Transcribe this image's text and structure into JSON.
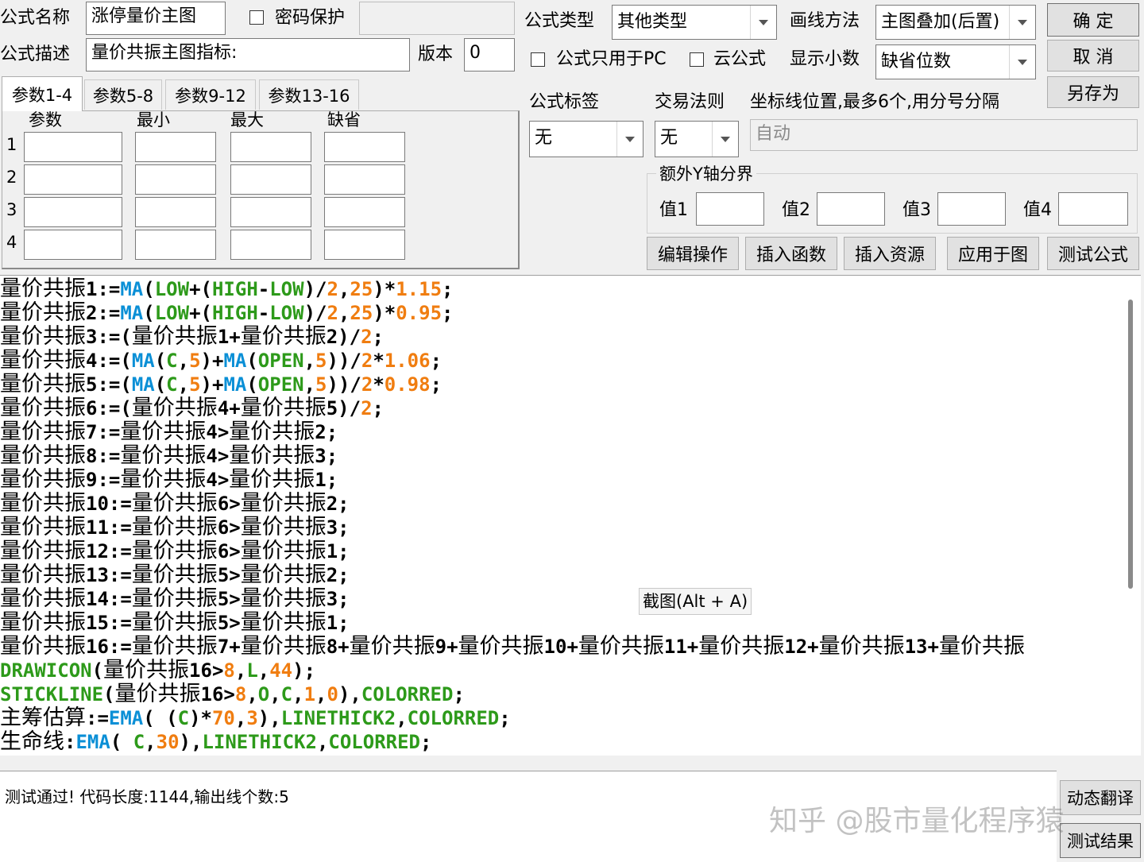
{
  "top": {
    "name_label": "公式名称",
    "name_value": "涨停量价主图",
    "password_label": "密码保护",
    "desc_label": "公式描述",
    "desc_value": "量价共振主图指标:",
    "version_label": "版本",
    "version_value": "0",
    "type_label": "公式类型",
    "type_value": "其他类型",
    "draw_label": "画线方法",
    "draw_value": "主图叠加(后置)",
    "pc_only_label": "公式只用于PC",
    "cloud_label": "云公式",
    "decimal_label": "显示小数",
    "decimal_value": "缺省位数",
    "ok": "确  定",
    "cancel": "取  消",
    "save_as": "另存为"
  },
  "tabs": [
    "参数1-4",
    "参数5-8",
    "参数9-12",
    "参数13-16"
  ],
  "params": {
    "headers": [
      "参数",
      "最小",
      "最大",
      "缺省"
    ],
    "rows": [
      "1",
      "2",
      "3",
      "4"
    ]
  },
  "right": {
    "tag_label": "公式标签",
    "tag_value": "无",
    "rule_label": "交易法则",
    "rule_value": "无",
    "axis_label": "坐标线位置,最多6个,用分号分隔",
    "axis_placeholder": "自动",
    "yaxis_group": "额外Y轴分界",
    "v1": "值1",
    "v2": "值2",
    "v3": "值3",
    "v4": "值4"
  },
  "actions": [
    "编辑操作",
    "插入函数",
    "插入资源",
    "应用于图",
    "测试公式"
  ],
  "code_lines": [
    "量价共振1:=MA(LOW+(HIGH-LOW)/2,25)*1.15;",
    "量价共振2:=MA(LOW+(HIGH-LOW)/2,25)*0.95;",
    "量价共振3:=(量价共振1+量价共振2)/2;",
    "量价共振4:=(MA(C,5)+MA(OPEN,5))/2*1.06;",
    "量价共振5:=(MA(C,5)+MA(OPEN,5))/2*0.98;",
    "量价共振6:=(量价共振4+量价共振5)/2;",
    "量价共振7:=量价共振4>量价共振2;",
    "量价共振8:=量价共振4>量价共振3;",
    "量价共振9:=量价共振4>量价共振1;",
    "量价共振10:=量价共振6>量价共振2;",
    "量价共振11:=量价共振6>量价共振3;",
    "量价共振12:=量价共振6>量价共振1;",
    "量价共振13:=量价共振5>量价共振2;",
    "量价共振14:=量价共振5>量价共振3;",
    "量价共振15:=量价共振5>量价共振1;",
    "量价共振16:=量价共振7+量价共振8+量价共振9+量价共振10+量价共振11+量价共振12+量价共振13+量价共振",
    "DRAWICON(量价共振16>8,L,44);",
    "STICKLINE(量价共振16>8,O,C,1,0),COLORRED;",
    "主筹估算:=EMA( (C)*70,3),LINETHICK2,COLORRED;",
    "生命线:EMA( C,30),LINETHICK2,COLORRED;"
  ],
  "tooltip": "截图(Alt + A)",
  "status": "测试通过! 代码长度:1144,输出线个数:5",
  "dyn_translate": "动态翻译",
  "test_result": "测试结果",
  "watermark": "知乎 @股市量化程序猿",
  "colors": {
    "function": "#0a8fd6",
    "number": "#f07d10",
    "keyword": "#2d9a1a"
  }
}
